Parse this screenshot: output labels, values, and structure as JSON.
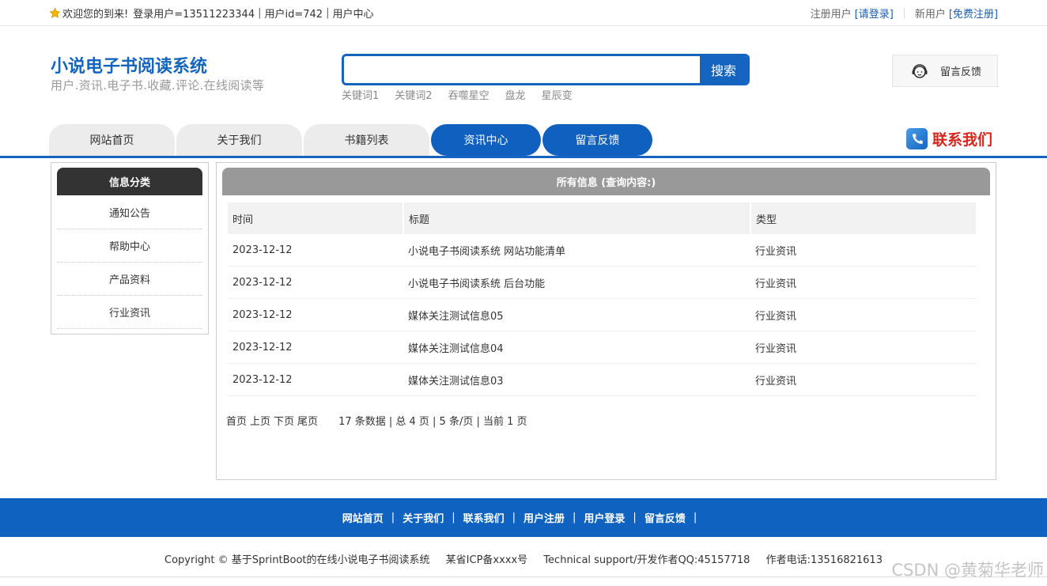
{
  "topbar": {
    "welcome": "欢迎您的到来!",
    "login_user": "登录用户=13511223344",
    "user_id": "用户id=742",
    "user_center": "用户中心",
    "reg_user_label": "注册用户",
    "login_link": "[请登录]",
    "new_user_label": "新用户",
    "register_link": "[免费注册]"
  },
  "header": {
    "title": "小说电子书阅读系统",
    "subtitle": "用户.资讯.电子书.收藏.评论.在线阅读等",
    "search_placeholder": "",
    "search_button": "搜索",
    "keywords": [
      "关键词1",
      "关键词2",
      "吞噬星空",
      "盘龙",
      "星辰变"
    ],
    "feedback_label": "留言反馈"
  },
  "nav": {
    "tabs": [
      "网站首页",
      "关于我们",
      "书籍列表",
      "资讯中心",
      "留言反馈"
    ],
    "contact": "联系我们"
  },
  "sidebar": {
    "title": "信息分类",
    "items": [
      "通知公告",
      "帮助中心",
      "产品资料",
      "行业资讯"
    ]
  },
  "main": {
    "title": "所有信息 (查询内容:)",
    "columns": [
      "时间",
      "标题",
      "类型"
    ],
    "rows": [
      {
        "date": "2023-12-12",
        "title": "小说电子书阅读系统 网站功能清单",
        "type": "行业资讯"
      },
      {
        "date": "2023-12-12",
        "title": "小说电子书阅读系统 后台功能",
        "type": "行业资讯"
      },
      {
        "date": "2023-12-12",
        "title": "媒体关注测试信息05",
        "type": "行业资讯"
      },
      {
        "date": "2023-12-12",
        "title": "媒体关注测试信息04",
        "type": "行业资讯"
      },
      {
        "date": "2023-12-12",
        "title": "媒体关注测试信息03",
        "type": "行业资讯"
      }
    ],
    "pager": {
      "first": "首页",
      "prev": "上页",
      "next": "下页",
      "last": "尾页",
      "info": "17 条数据 | 总 4 页 | 5 条/页 | 当前 1 页"
    }
  },
  "footer": {
    "links": [
      "网站首页",
      "关于我们",
      "联系我们",
      "用户注册",
      "用户登录",
      "留言反馈"
    ],
    "copyright": "Copyright © 基于SprintBoot的在线小说电子书阅读系统",
    "icp": "某省ICP备xxxx号",
    "support": "Technical support/开发作者QQ:45157718",
    "phone": "作者电话:13516821613"
  },
  "watermark": "CSDN @黄菊华老师",
  "colors": {
    "primary": "#1565c0",
    "nav_active": "#1060c0",
    "contact_red": "#d9261c",
    "sidebar_head": "#333333",
    "main_head": "#999999"
  }
}
